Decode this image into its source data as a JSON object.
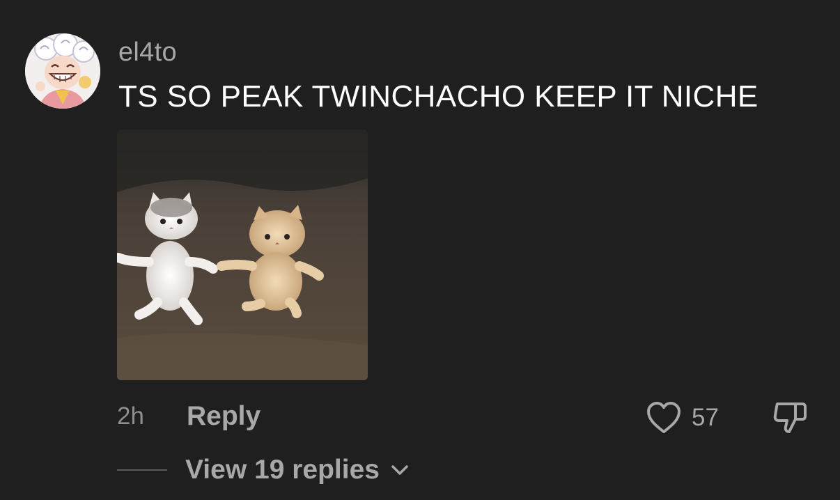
{
  "comment": {
    "avatar_icon": "anime-avatar-icon",
    "username": "el4to",
    "text": "TS SO PEAK TWINCHACHO KEEP IT NICHE",
    "media_icon": "dancing-kittens-image",
    "timestamp": "2h",
    "reply_label": "Reply",
    "like_icon": "heart-icon",
    "like_count": "57",
    "dislike_icon": "thumbs-down-icon",
    "view_replies_label": "View 19 replies",
    "expand_icon": "chevron-down-icon"
  },
  "colors": {
    "background": "#1f1f1f",
    "primary_text": "#ffffff",
    "secondary_text": "#a8a8a8"
  }
}
